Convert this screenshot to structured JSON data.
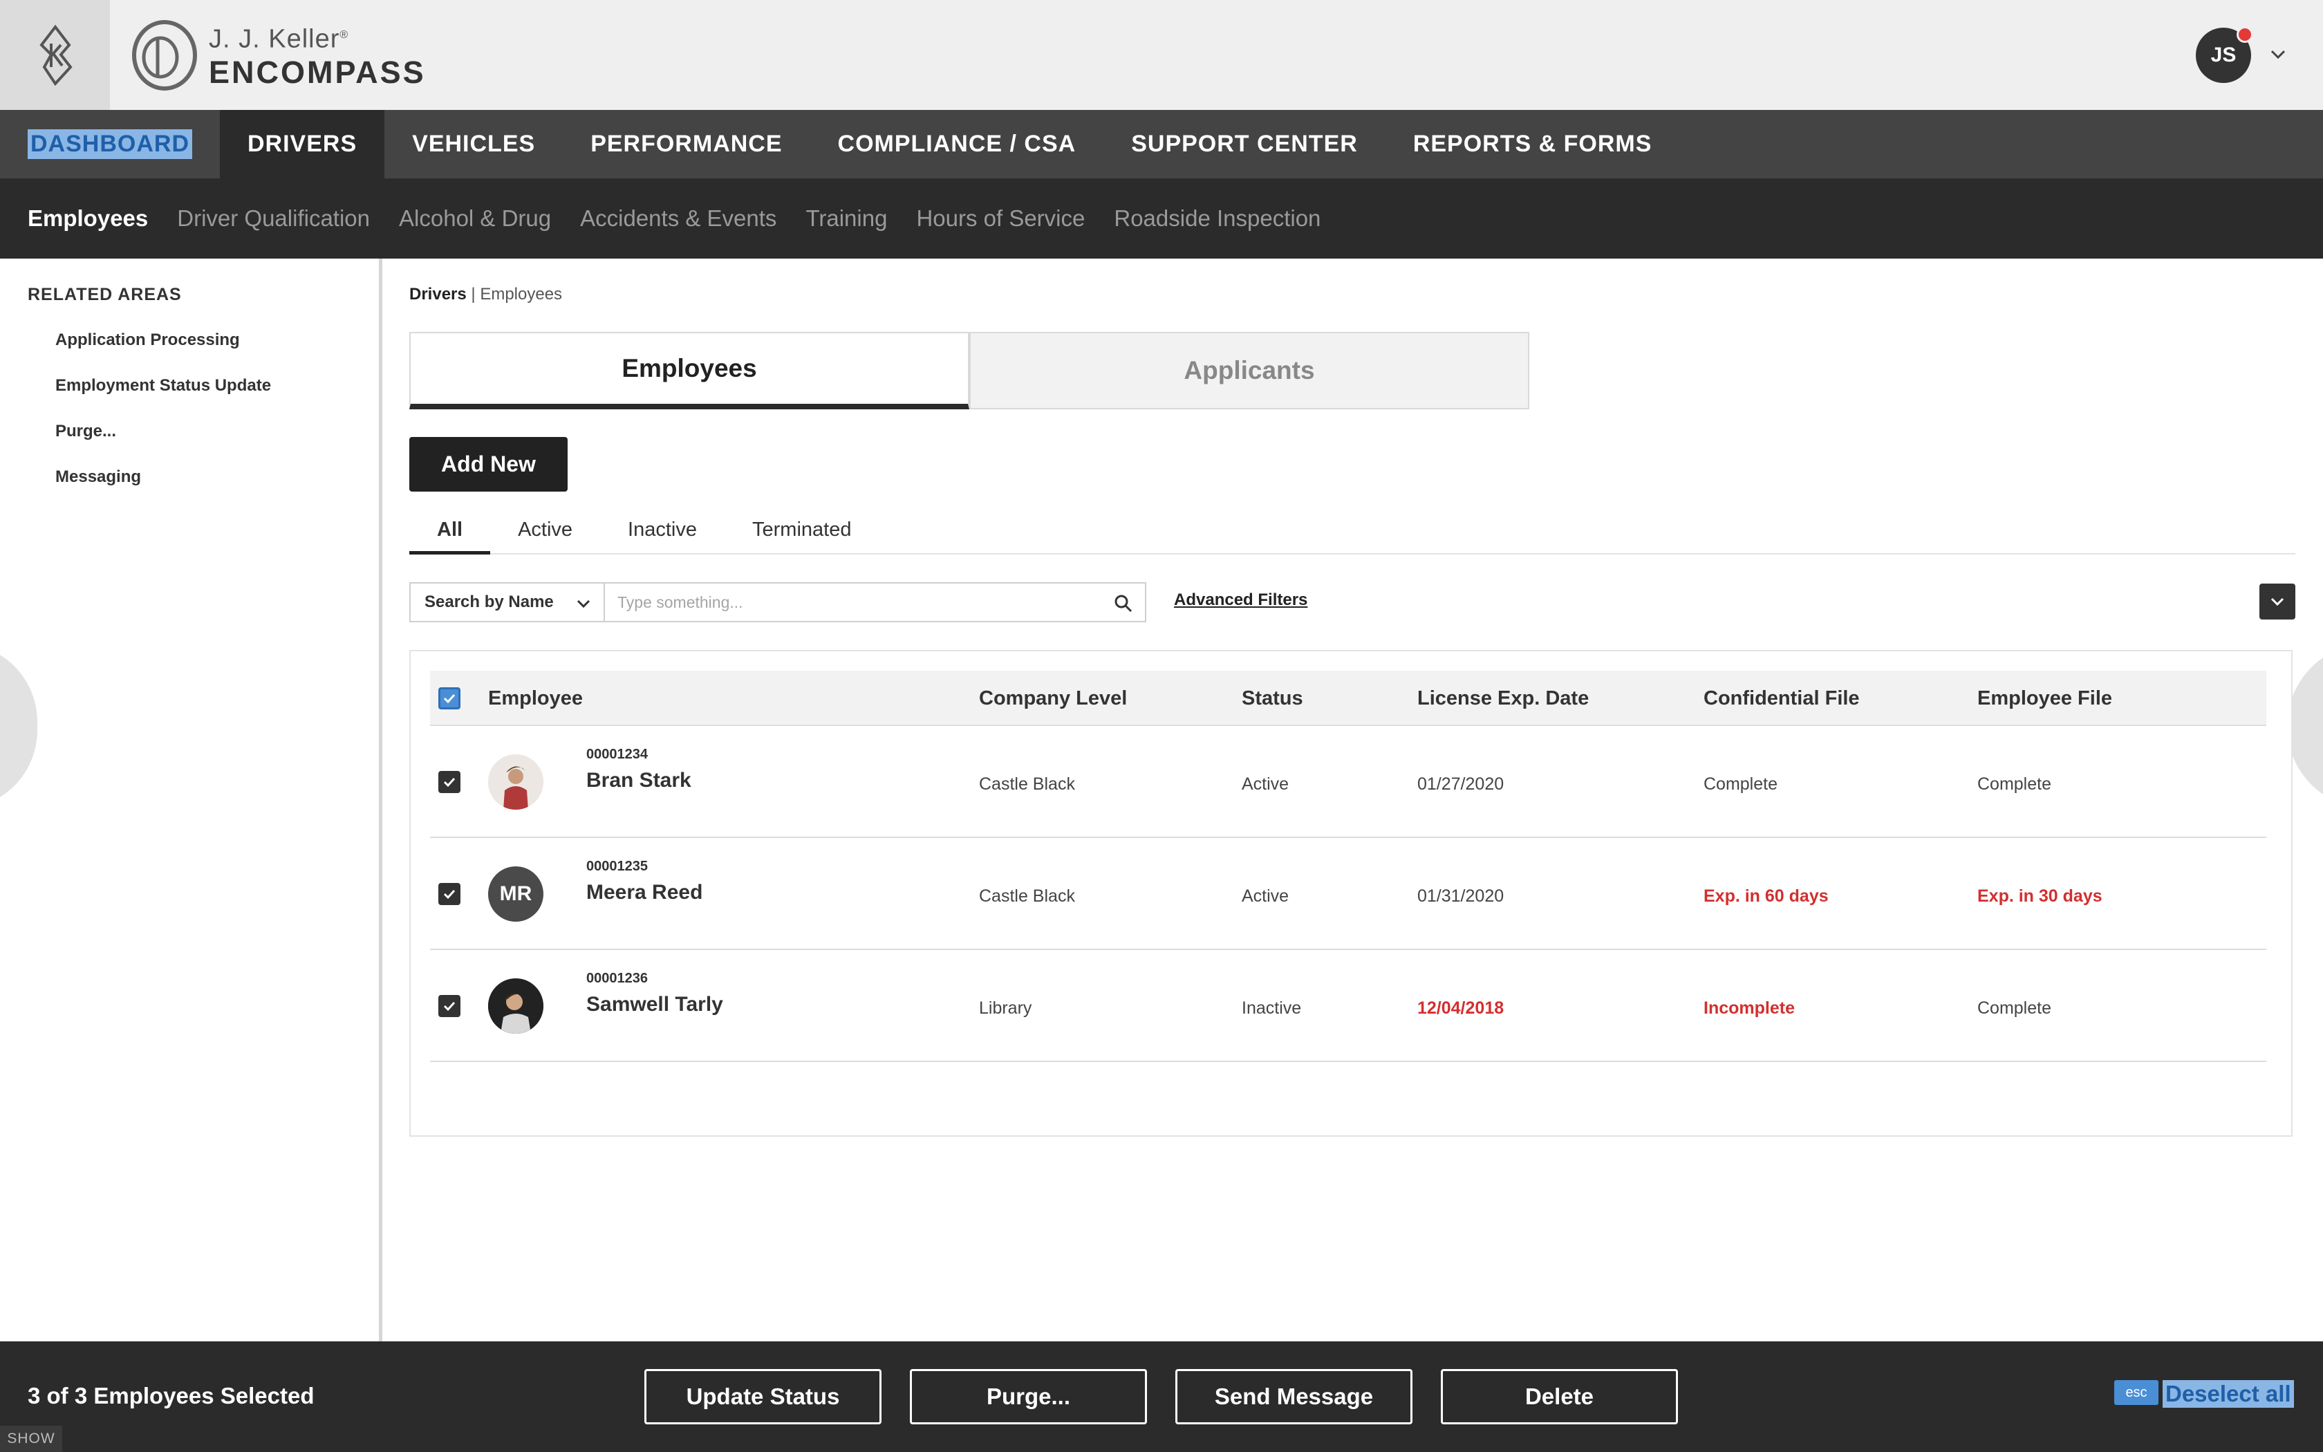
{
  "header": {
    "brand_line1": "J. J. Keller",
    "brand_registered": "®",
    "brand_line2": "ENCOMPASS",
    "user_initials": "JS",
    "icons": [
      "keller-k-logo-icon",
      "encompass-ring-icon",
      "notification-dot-icon",
      "chevron-down-icon"
    ],
    "notification_color": "#e53935"
  },
  "main_nav": {
    "items": [
      {
        "label": "DASHBOARD"
      },
      {
        "label": "DRIVERS"
      },
      {
        "label": "VEHICLES"
      },
      {
        "label": "PERFORMANCE"
      },
      {
        "label": "COMPLIANCE / CSA"
      },
      {
        "label": "SUPPORT CENTER"
      },
      {
        "label": "REPORTS & FORMS"
      }
    ],
    "active": "DRIVERS",
    "text_selected": "DASHBOARD"
  },
  "sub_nav": {
    "items": [
      {
        "label": "Employees"
      },
      {
        "label": "Driver Qualification"
      },
      {
        "label": "Alcohol & Drug"
      },
      {
        "label": "Accidents & Events"
      },
      {
        "label": "Training"
      },
      {
        "label": "Hours of Service"
      },
      {
        "label": "Roadside Inspection"
      }
    ],
    "active": "Employees"
  },
  "sidebar": {
    "heading": "RELATED AREAS",
    "links": [
      {
        "label": "Application Processing"
      },
      {
        "label": "Employment Status Update"
      },
      {
        "label": "Purge..."
      },
      {
        "label": "Messaging"
      }
    ]
  },
  "breadcrumb": {
    "root": "Drivers",
    "separator": "|",
    "current": "Employees"
  },
  "tabs": [
    {
      "label": "Employees",
      "active": true
    },
    {
      "label": "Applicants",
      "active": false
    }
  ],
  "add_button": "Add New",
  "filter_tabs": [
    {
      "label": "All",
      "active": true
    },
    {
      "label": "Active"
    },
    {
      "label": "Inactive"
    },
    {
      "label": "Terminated"
    }
  ],
  "search": {
    "select_label": "Search by Name",
    "placeholder": "Type something...",
    "advanced_filters": "Advanced Filters"
  },
  "table": {
    "columns": [
      "Employee",
      "Company Level",
      "Status",
      "License Exp. Date",
      "Confidential File",
      "Employee File"
    ],
    "rows": [
      {
        "id": "00001234",
        "name": "Bran Stark",
        "avatar": "photo",
        "company_level": "Castle Black",
        "status": "Active",
        "license_exp": "01/27/2020",
        "license_warn": false,
        "confidential_file": "Complete",
        "confidential_warn": false,
        "employee_file": "Complete",
        "employee_warn": false,
        "checked": true
      },
      {
        "id": "00001235",
        "name": "Meera Reed",
        "avatar": "MR",
        "company_level": "Castle Black",
        "status": "Active",
        "license_exp": "01/31/2020",
        "license_warn": false,
        "confidential_file": "Exp. in 60 days",
        "confidential_warn": true,
        "employee_file": "Exp. in 30 days",
        "employee_warn": true,
        "checked": true
      },
      {
        "id": "00001236",
        "name": "Samwell Tarly",
        "avatar": "photo",
        "company_level": "Library",
        "status": "Inactive",
        "license_exp": "12/04/2018",
        "license_warn": true,
        "confidential_file": "Incomplete",
        "confidential_warn": true,
        "employee_file": "Complete",
        "employee_warn": false,
        "checked": true
      }
    ],
    "warn_color": "#d32f2f"
  },
  "action_bar": {
    "selected_text": "3 of 3 Employees Selected",
    "buttons": [
      {
        "label": "Update Status"
      },
      {
        "label": "Purge..."
      },
      {
        "label": "Send Message"
      },
      {
        "label": "Delete"
      }
    ],
    "esc_label": "esc",
    "deselect_label": "Deselect all",
    "show_label": "SHOW"
  }
}
